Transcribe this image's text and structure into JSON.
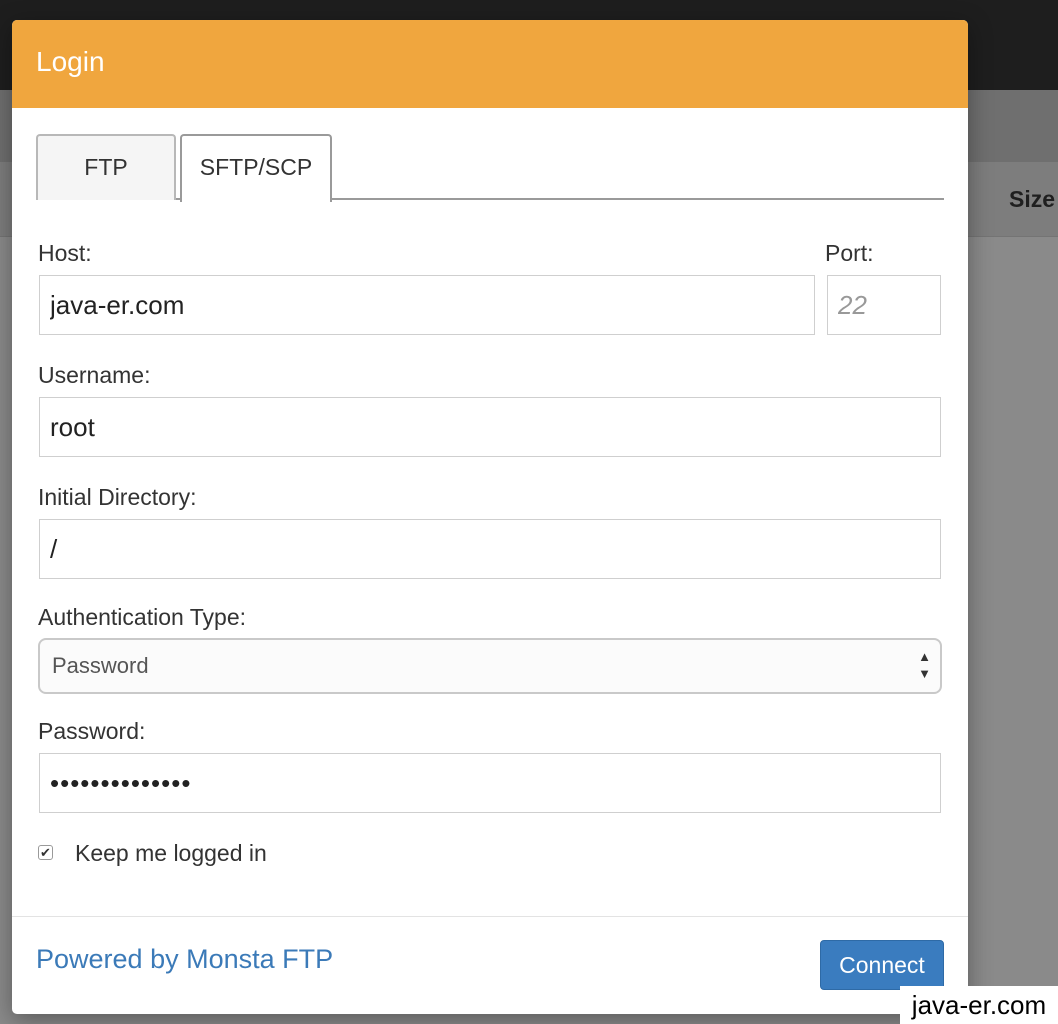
{
  "background": {
    "column_header_size": "Size"
  },
  "modal": {
    "title": "Login",
    "tabs": [
      {
        "label": "FTP",
        "active": false
      },
      {
        "label": "SFTP/SCP",
        "active": true
      }
    ],
    "host": {
      "label": "Host:",
      "value": "java-er.com"
    },
    "port": {
      "label": "Port:",
      "value": "",
      "placeholder": "22"
    },
    "username": {
      "label": "Username:",
      "value": "root"
    },
    "initial_directory": {
      "label": "Initial Directory:",
      "value": "/"
    },
    "auth_type": {
      "label": "Authentication Type:",
      "selected": "Password",
      "arrows": "▲▼"
    },
    "password": {
      "label": "Password:",
      "value": "••••••••••••••"
    },
    "keep_logged_in": {
      "label": "Keep me logged in",
      "checked": true,
      "mark": "✔"
    },
    "footer": {
      "powered_by": "Powered by Monsta FTP",
      "connect_label": "Connect"
    }
  },
  "watermark": "java-er.com",
  "colors": {
    "header_orange": "#f0a63e",
    "link_blue": "#3b7ab8",
    "button_blue": "#3a7cbf"
  }
}
